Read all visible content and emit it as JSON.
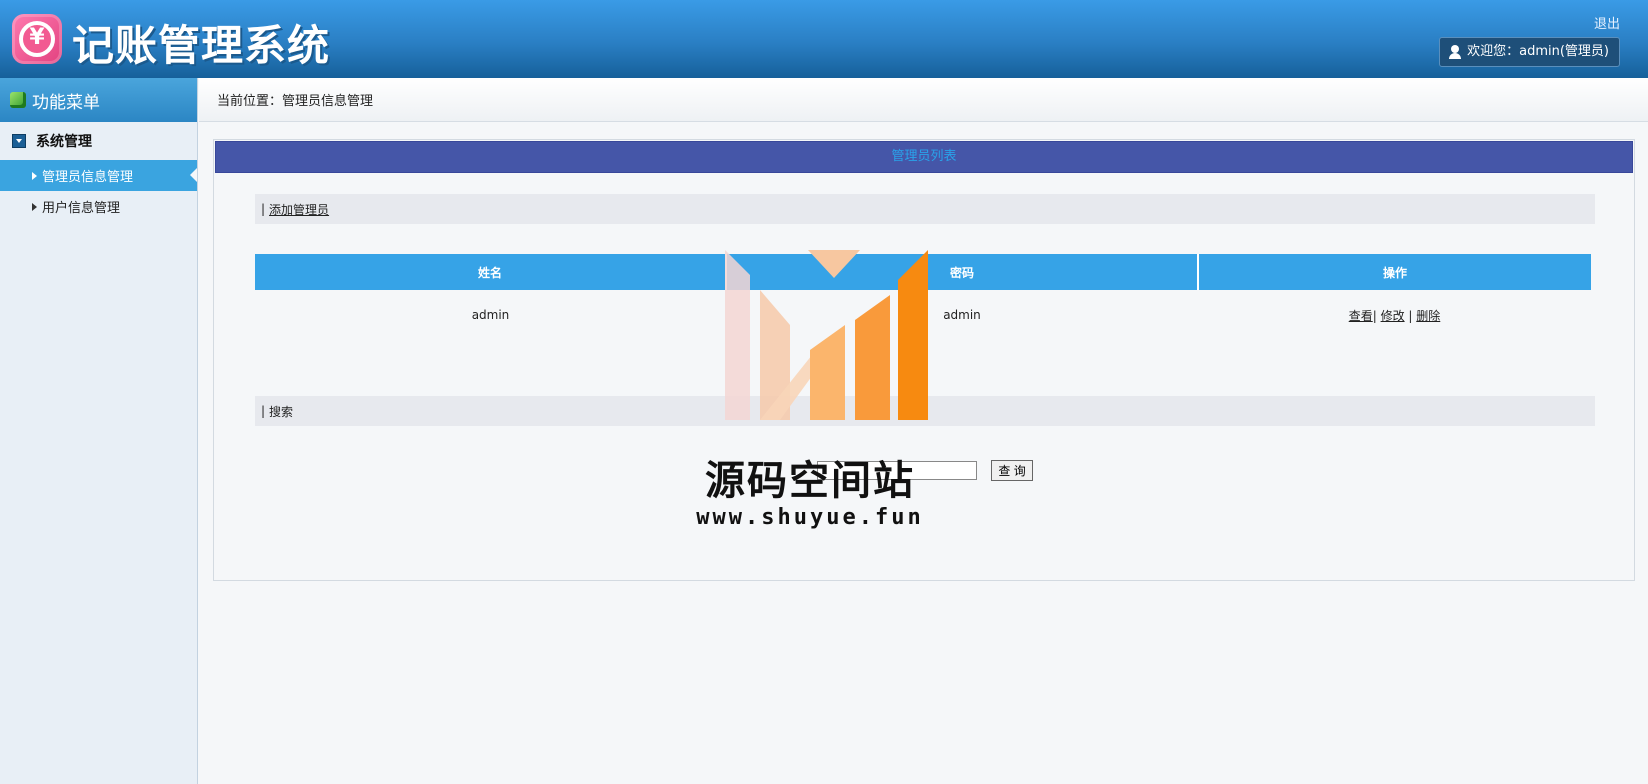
{
  "header": {
    "app_title": "记账管理系统",
    "logout_label": "退出",
    "welcome_text": "欢迎您：admin(管理员)",
    "logo_symbol": "¥"
  },
  "sidebar": {
    "title": "功能菜单",
    "groups": [
      {
        "title": "系统管理",
        "items": [
          {
            "label": "管理员信息管理",
            "active": true
          },
          {
            "label": "用户信息管理",
            "active": false
          }
        ]
      }
    ]
  },
  "breadcrumb": {
    "text": "当前位置：管理员信息管理"
  },
  "panel": {
    "title": "管理员列表",
    "add_section": {
      "prefix": "|",
      "link_label": "添加管理员"
    },
    "table": {
      "columns": [
        "姓名",
        "密码",
        "操作"
      ],
      "rows": [
        {
          "name": "admin",
          "password": "admin",
          "actions": [
            "查看",
            "修改",
            "删除"
          ]
        }
      ]
    },
    "search_section": {
      "prefix": "|",
      "label": "搜索"
    },
    "search": {
      "value": "",
      "button_label": "查 询"
    }
  },
  "watermark": {
    "title": "源码空间站",
    "url": "www.shuyue.fun"
  },
  "colors": {
    "header": "#2a7fc4",
    "panel_title_bg": "#4556a8",
    "table_header": "#36a3e7",
    "active_menu": "#3aa4e0"
  }
}
